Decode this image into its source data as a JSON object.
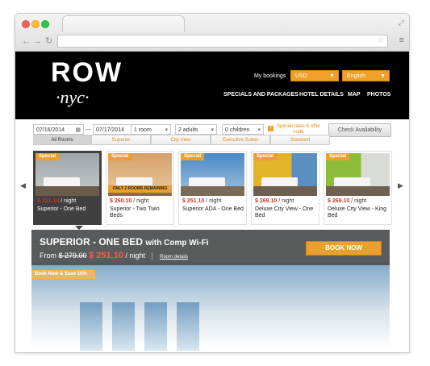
{
  "header": {
    "logo_top": "ROW",
    "logo_bottom": "·nyc·",
    "my_bookings": "My bookings",
    "currency": "USD",
    "language": "English",
    "nav": [
      "SPECIALS AND PACKAGES",
      "HOTEL DETAILS",
      "MAP",
      "PHOTOS"
    ]
  },
  "search": {
    "checkin": "07/16/2014",
    "checkout": "07/17/2014",
    "rooms": "1 room",
    "adults": "2 adults",
    "children": "0 children",
    "special_rates": "Special rates & offer code",
    "check_availability": "Check Availability"
  },
  "tabs": [
    "All Rooms",
    "Superior",
    "City View",
    "Executive Suites",
    "Standard"
  ],
  "active_tab": 0,
  "cards": [
    {
      "badge": "Special",
      "price": "$ 251.10",
      "per_night": "/ night",
      "name": "Superior - One Bed",
      "selected": true,
      "color": "#9fa4a8"
    },
    {
      "badge": "Special",
      "price": "$ 260.10",
      "per_night": "/ night",
      "name": "Superior - Two Twin Beds",
      "remaining": "ONLY 2 ROOMS REMAINING",
      "color": "#d6a06a"
    },
    {
      "badge": "Special",
      "price": "$ 251.10",
      "per_night": "/ night",
      "name": "Superior ADA - One Bed",
      "color": "#4a88c4"
    },
    {
      "badge": "Special",
      "price": "$ 269.10",
      "per_night": "/ night",
      "name": "Deluxe City View - One Bed",
      "color": "#e2b42a"
    },
    {
      "badge": "Special",
      "price": "$ 269.10",
      "per_night": "/ night",
      "name": "Deluxe City View - King Bed",
      "color": "#8bbd3a"
    }
  ],
  "detail": {
    "title": "SUPERIOR - ONE BED",
    "subtitle": "with Comp Wi-Fi",
    "from_label": "From",
    "old_price": "$ 279.00",
    "new_price": "$ 251.10",
    "per_night": "/ night",
    "room_details": "Room details",
    "book_now": "BOOK NOW",
    "ribbon": "Book Now & Save 10%"
  }
}
